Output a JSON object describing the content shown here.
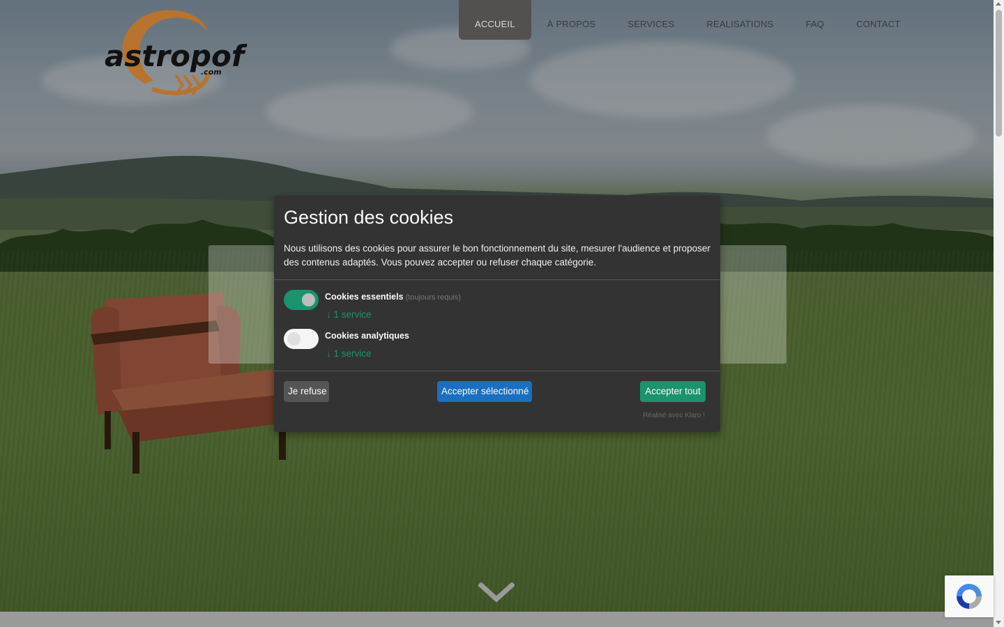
{
  "logo": {
    "text": "astropof",
    "subtext": ".com"
  },
  "nav": {
    "items": [
      {
        "label": "ACCUEIL",
        "active": true
      },
      {
        "label": "À PROPOS",
        "active": false
      },
      {
        "label": "SERVICES",
        "active": false
      },
      {
        "label": "REALISATIONS",
        "active": false
      },
      {
        "label": "FAQ",
        "active": false
      },
      {
        "label": "CONTACT",
        "active": false
      }
    ]
  },
  "cookie_modal": {
    "title": "Gestion des cookies",
    "description": "Nous utilisons des cookies pour assurer le bon fonctionnement du site, mesurer l'audience et proposer des contenus adaptés. Vous pouvez accepter ou refuser chaque catégorie.",
    "purposes": [
      {
        "title": "Cookies essentiels",
        "required_note": "(toujours requis)",
        "services": "↓ 1 service",
        "enabled": true
      },
      {
        "title": "Cookies analytiques",
        "required_note": "",
        "services": "↓ 1 service",
        "enabled": false
      }
    ],
    "buttons": {
      "decline": "Je refuse",
      "accept_selected": "Accepter sélectionné",
      "accept_all": "Accepter tout"
    },
    "powered_by": "Réalisé avec Klaro !"
  },
  "colors": {
    "accent_green": "#1a936f",
    "accent_blue": "#1a6fc0",
    "modal_bg": "#333333",
    "logo_orange": "#b8732e",
    "nav_active_bg": "#555050"
  },
  "icons": {
    "scroll_down": "chevron-down-icon",
    "recaptcha": "recaptcha-icon"
  }
}
